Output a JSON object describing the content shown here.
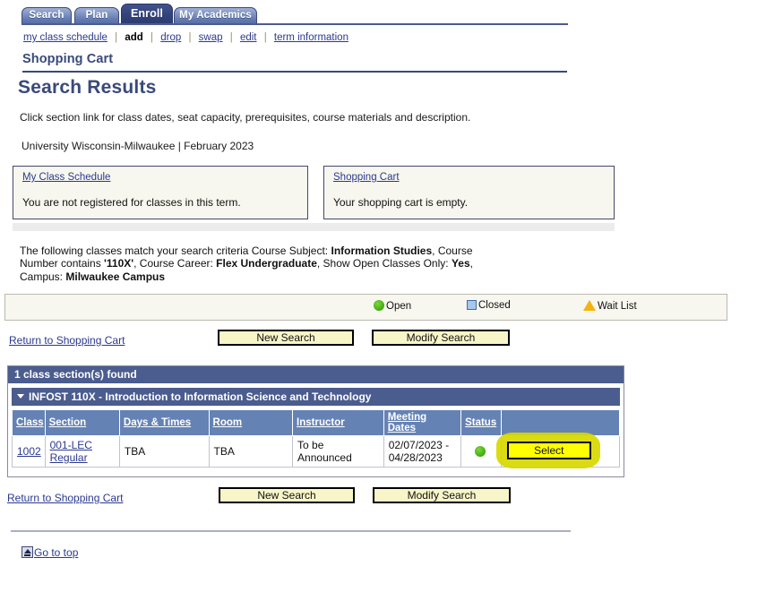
{
  "tabs": [
    {
      "label": "Search",
      "accel": "r",
      "active": false
    },
    {
      "label": "Plan",
      "accel": "P",
      "active": false
    },
    {
      "label": "Enroll",
      "accel": "",
      "active": true
    },
    {
      "label": "My Academics",
      "accel": "M",
      "active": false
    }
  ],
  "subnav": {
    "items": [
      {
        "label": "my class schedule",
        "current": false
      },
      {
        "label": "add",
        "current": true
      },
      {
        "label": "drop",
        "current": false
      },
      {
        "label": "swap",
        "current": false
      },
      {
        "label": "edit",
        "current": false
      },
      {
        "label": "term information",
        "current": false
      }
    ],
    "separator": "|"
  },
  "group_title": "Shopping Cart",
  "page_title": "Search Results",
  "instructions": "Click section link for class dates, seat capacity, prerequisites, course materials and description.",
  "term_line": "University Wisconsin-Milwaukee | February 2023",
  "info_boxes": [
    {
      "link": "My Class Schedule",
      "text": "You are not registered for classes in this term."
    },
    {
      "link": "Shopping Cart",
      "text": "Your shopping cart is empty."
    }
  ],
  "criteria": {
    "part1": "The following classes match your search criteria Course Subject: ",
    "subject": "Information Studies",
    "part2": ",  Course Number contains ",
    "number": "'110X'",
    "part3": ",  Course Career: ",
    "career": "Flex Undergraduate",
    "part4": ",  Show Open Classes Only: ",
    "open_only": "Yes",
    "part5": ",  Campus: ",
    "campus": "Milwaukee Campus"
  },
  "legend": [
    {
      "label": "Open",
      "icon": "green-circle-icon",
      "color": "#4cb518"
    },
    {
      "label": "Closed",
      "icon": "blue-square-icon",
      "color": "#a9c7ec"
    },
    {
      "label": "Wait List",
      "icon": "orange-triangle-icon",
      "color": "#f5b30d"
    }
  ],
  "actions": {
    "return_to_cart": "Return to Shopping Cart",
    "new_search": "New Search",
    "modify_search": "Modify Search"
  },
  "results": {
    "count_label": "1 class section(s) found",
    "course_header": "INFOST 110X - Introduction to Information Science and Technology",
    "columns": [
      "Class",
      "Section",
      "Days & Times",
      "Room",
      "Instructor",
      "Meeting Dates",
      "Status",
      ""
    ],
    "rows": [
      {
        "class": "1002",
        "section_line1": "001-LEC",
        "section_line2": "Regular",
        "days_times": "TBA",
        "room": "TBA",
        "instructor": "To be Announced",
        "meeting_dates_line1": "02/07/2023 -",
        "meeting_dates_line2": "04/28/2023",
        "status": "Open",
        "status_icon": "green-circle-icon",
        "select_label": "Select"
      }
    ]
  },
  "footer": {
    "go_to_top": "Go to top",
    "go_to_top_icon": "up-arrow-icon"
  }
}
